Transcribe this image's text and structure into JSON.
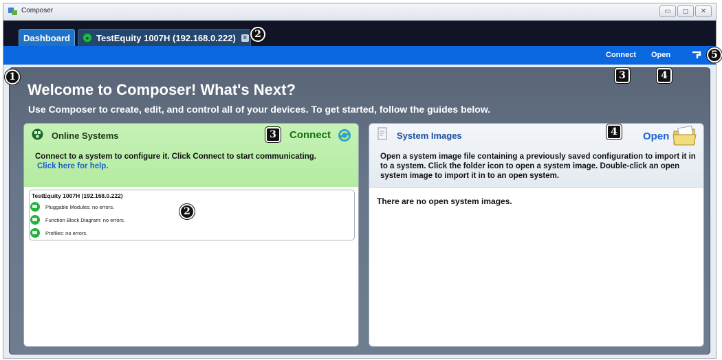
{
  "window": {
    "title": "Composer"
  },
  "window_controls": [
    "minimize",
    "maximize",
    "close"
  ],
  "tabs": [
    {
      "label": "Dashboard",
      "active": true
    },
    {
      "label": "TestEquity 1007H (192.168.0.222)",
      "status": "connected",
      "closable": true
    }
  ],
  "toolbar": {
    "connect_label": "Connect",
    "open_label": "Open",
    "help_icon": "help-icon"
  },
  "welcome": {
    "title": "Welcome to Composer! What's Next?",
    "subtitle": "Use Composer to create, edit, and control all of your devices. To get started, follow the guides below."
  },
  "online_systems": {
    "title": "Online Systems",
    "action_label": "Connect",
    "description": "Connect to a system to configure it. Click Connect to start communicating.",
    "help_link": "Click here for help.",
    "system": {
      "name": "TestEquity 1007H (192.168.0.222)",
      "rows": [
        "Pluggable Modules: no errors.",
        "Function Block Diagram: no errors.",
        "Profiles: no errors."
      ]
    }
  },
  "system_images": {
    "title": "System Images",
    "action_label": "Open",
    "description": "Open a system image file containing a previously saved configuration to import it in to a system. Click the folder icon to open a system image. Double-click an open system image to import it in to an open system.",
    "empty_text": "There are no open system images."
  },
  "callouts": {
    "c1": "1",
    "c2": "2",
    "c3": "3",
    "c4": "4",
    "c5": "5"
  },
  "colors": {
    "toolbar": "#0b67e0",
    "tab_active": "#1e73c8",
    "online_header": "#c6f2b6",
    "status_ok": "#23b23f"
  }
}
